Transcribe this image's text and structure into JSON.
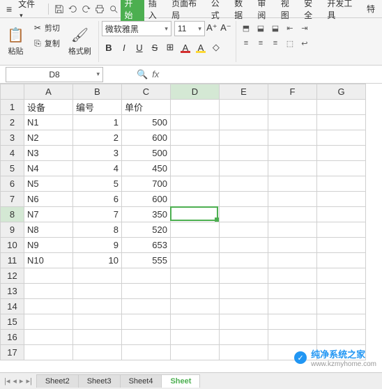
{
  "menubar": {
    "file_label": "文件",
    "tabs": [
      "开始",
      "插入",
      "页面布局",
      "公式",
      "数据",
      "审阅",
      "视图",
      "安全",
      "开发工具",
      "特"
    ]
  },
  "ribbon": {
    "paste_label": "粘贴",
    "cut_label": "剪切",
    "copy_label": "复制",
    "format_painter_label": "格式刷",
    "font_name": "微软雅黑",
    "font_size": "11"
  },
  "namebox": {
    "value": "D8"
  },
  "grid": {
    "columns": [
      "A",
      "B",
      "C",
      "D",
      "E",
      "F",
      "G"
    ],
    "headers": {
      "a": "设备",
      "b": "编号",
      "c": "单价"
    },
    "rows": [
      {
        "a": "N1",
        "b": "1",
        "c": "500"
      },
      {
        "a": "N2",
        "b": "2",
        "c": "600"
      },
      {
        "a": "N3",
        "b": "3",
        "c": "500"
      },
      {
        "a": "N4",
        "b": "4",
        "c": "450"
      },
      {
        "a": "N5",
        "b": "5",
        "c": "700"
      },
      {
        "a": "N6",
        "b": "6",
        "c": "600"
      },
      {
        "a": "N7",
        "b": "7",
        "c": "350"
      },
      {
        "a": "N8",
        "b": "8",
        "c": "520"
      },
      {
        "a": "N9",
        "b": "9",
        "c": "653"
      },
      {
        "a": "N10",
        "b": "10",
        "c": "555"
      }
    ],
    "selected_cell": "D8"
  },
  "sheets": {
    "tabs": [
      "Sheet2",
      "Sheet3",
      "Sheet4",
      "Sheet"
    ]
  },
  "watermark": {
    "text": "纯净系统之家",
    "url": "www.kzmyhome.com"
  }
}
